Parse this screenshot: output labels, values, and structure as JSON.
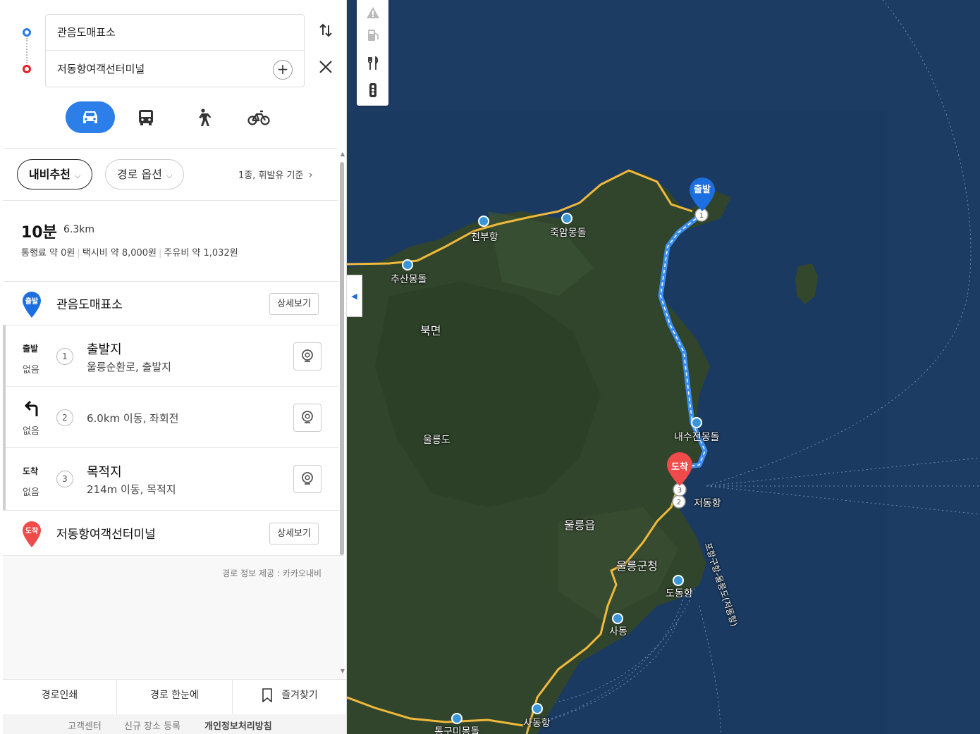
{
  "search": {
    "origin": "관음도매표소",
    "destination": "저동항여객선터미널",
    "add_icon": "plus-icon",
    "swap_icon": "swap-vertical-icon",
    "close_icon": "close-icon"
  },
  "modes": [
    {
      "name": "car",
      "icon": "car-icon",
      "active": true
    },
    {
      "name": "bus",
      "icon": "bus-icon",
      "active": false
    },
    {
      "name": "walk",
      "icon": "walk-icon",
      "active": false
    },
    {
      "name": "bike",
      "icon": "bike-icon",
      "active": false
    }
  ],
  "options": {
    "recommend": "내비추천",
    "route_option": "경로 옵션",
    "fuel_basis": "1종, 휘발유 기준"
  },
  "summary": {
    "time": "10분",
    "distance": "6.3km",
    "toll": "통행료 약 0원",
    "taxi": "택시비 약 8,000원",
    "fuel": "주유비 약 1,032원"
  },
  "origin_row": {
    "pin_label": "출발",
    "name": "관음도매표소",
    "detail": "상세보기"
  },
  "dest_row": {
    "pin_label": "도착",
    "name": "저동항여객선터미널",
    "detail": "상세보기"
  },
  "steps": [
    {
      "tag": "출발",
      "sub": "없음",
      "num": "1",
      "title": "출발지",
      "desc": "울릉순환로, 출발지"
    },
    {
      "tag": "",
      "sub": "없음",
      "num": "2",
      "title": "",
      "desc": "6.0km 이동, 좌회전"
    },
    {
      "tag": "도착",
      "sub": "없음",
      "num": "3",
      "title": "목적지",
      "desc": "214m 이동, 목적지"
    }
  ],
  "provider": "경로 정보 제공 : 카카오내비",
  "bottom": {
    "print": "경로인쇄",
    "overview": "경로 한눈에",
    "favorite": "즐겨찾기"
  },
  "footer": {
    "support": "고객센터",
    "register": "신규 장소 등록",
    "privacy": "개인정보처리방침"
  },
  "map": {
    "tools": [
      "warning-icon",
      "fuel-icon",
      "restaurant-icon",
      "traffic-icon"
    ],
    "labels": {
      "cheonbu": "천부항",
      "jukam": "죽암몽돌",
      "chusan": "추산몽돌",
      "bukmyeon": "북면",
      "ulleungdo": "울릉도",
      "naesu": "내수전몽돌",
      "ulleungeup": "울릉읍",
      "gunhall": "울릉군청",
      "dodong": "도동항",
      "sadong": "사동",
      "sadong_port": "사동항",
      "tonggumi": "통구미몽돌",
      "jeodong": "저동항",
      "sea_route": "포항구항-울릉도(저동항)"
    },
    "start_pin": "출발",
    "end_pin": "도착",
    "route_color": "#3b8ef0",
    "road_color": "#f0b93c"
  }
}
